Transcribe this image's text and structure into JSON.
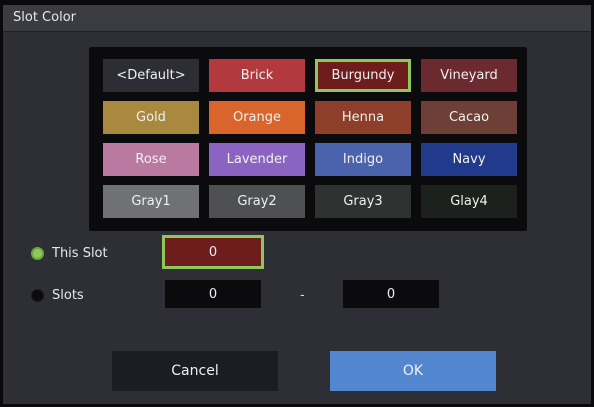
{
  "window": {
    "title": "Slot Color"
  },
  "palette": [
    {
      "label": "<Default>",
      "color": "#2c2e34"
    },
    {
      "label": "Brick",
      "color": "#b23a3e"
    },
    {
      "label": "Burgundy",
      "color": "#6e1d1d",
      "selected": true
    },
    {
      "label": "Vineyard",
      "color": "#6b2a30"
    },
    {
      "label": "Gold",
      "color": "#a8893e"
    },
    {
      "label": "Orange",
      "color": "#d9642c"
    },
    {
      "label": "Henna",
      "color": "#8d3f2a"
    },
    {
      "label": "Cacao",
      "color": "#6e3f36"
    },
    {
      "label": "Rose",
      "color": "#b979a0"
    },
    {
      "label": "Lavender",
      "color": "#8a64c0"
    },
    {
      "label": "Indigo",
      "color": "#4b62ad"
    },
    {
      "label": "Navy",
      "color": "#223a8c"
    },
    {
      "label": "Gray1",
      "color": "#707174"
    },
    {
      "label": "Gray2",
      "color": "#4f5052"
    },
    {
      "label": "Gray3",
      "color": "#2e3231"
    },
    {
      "label": "Glay4",
      "color": "#1c211e"
    }
  ],
  "this_slot": {
    "label": "This Slot",
    "value": "0",
    "selected": true
  },
  "slots": {
    "label": "Slots",
    "from_value": "0",
    "separator": "-",
    "to_value": "0",
    "selected": false
  },
  "buttons": {
    "cancel": "Cancel",
    "ok": "OK"
  },
  "colors": {
    "dialog_bg": "#2e2f34",
    "accent_green": "#8fc75a",
    "field_bg": "#0b0b0d",
    "this_slot_field_bg": "#6e1d1d",
    "cancel_bg": "#1c1d22",
    "ok_bg": "#5287cf"
  }
}
